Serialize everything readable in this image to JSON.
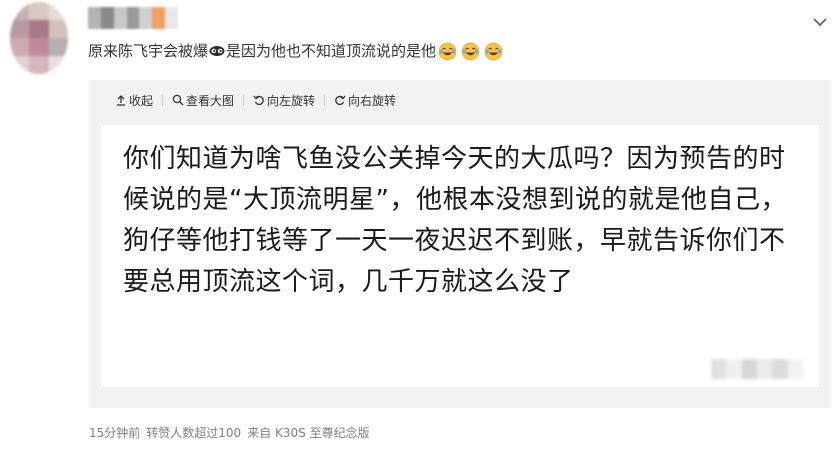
{
  "post": {
    "text_before_eye": "原来陈飞宇会被爆",
    "text_after_eye": "是因为他也不知道顶流说的是他",
    "eye_emoji": "sunglasses-eyes-icon",
    "laugh_emoji": "laugh-tears-icon",
    "laugh_count": 3
  },
  "toolbar": {
    "collapse_label": "收起",
    "view_large_label": "查看大图",
    "rotate_left_label": "向左旋转",
    "rotate_right_label": "向右旋转"
  },
  "image": {
    "text": "你们知道为啥飞鱼没公关掉今天的大瓜吗？因为预告的时候说的是“大顶流明星”，他根本没想到说的就是他自己，狗仔等他打钱等了一天一夜迟迟不到账，早就告诉你们不要总用顶流这个词，几千万就这么没了"
  },
  "footer": {
    "time": "15分钟前",
    "reposts": "转赞人数超过100",
    "source": "来自 K30S 至尊纪念版"
  },
  "colors": {
    "panel_bg": "#f2f2f5",
    "text": "#333333",
    "meta": "#808080"
  }
}
